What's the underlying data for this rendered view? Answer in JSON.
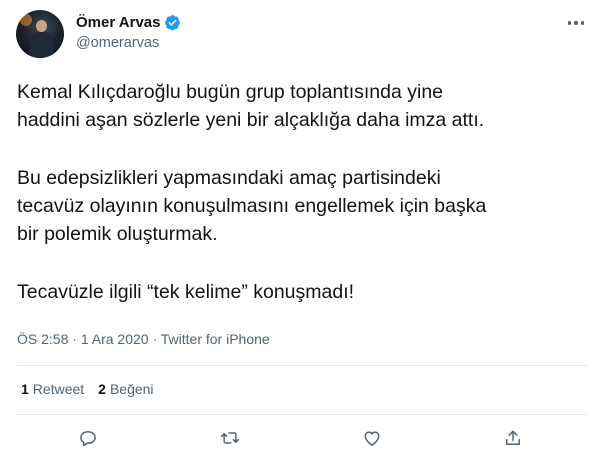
{
  "author": {
    "display_name": "Ömer Arvas",
    "handle": "@omerarvas",
    "verified_icon": "verified-badge-icon",
    "verified_color": "#1d9bf0"
  },
  "tweet": {
    "paragraphs": [
      [
        "Kemal Kılıçdaroğlu bugün grup toplantısında yine",
        "haddini aşan sözlerle yeni bir alçaklığa daha imza attı."
      ],
      [
        "Bu edepsizlikleri yapmasındaki amaç partisindeki",
        "tecavüz olayının konuşulmasını engellemek için başka",
        "bir polemik oluşturmak."
      ],
      [
        "Tecavüzle ilgili “tek kelime” konuşmadı!"
      ]
    ]
  },
  "meta": {
    "time": "ÖS 2:58",
    "separator": " · ",
    "date": "1 Ara 2020",
    "source": "Twitter for iPhone"
  },
  "stats": {
    "retweets_count": "1",
    "retweets_label": "Retweet",
    "likes_count": "2",
    "likes_label": "Beğeni"
  },
  "actions": [
    "reply-icon",
    "retweet-icon",
    "like-icon",
    "share-icon"
  ],
  "colors": {
    "text": "#0f1419",
    "secondary": "#536471",
    "divider": "#e1e8ed"
  }
}
